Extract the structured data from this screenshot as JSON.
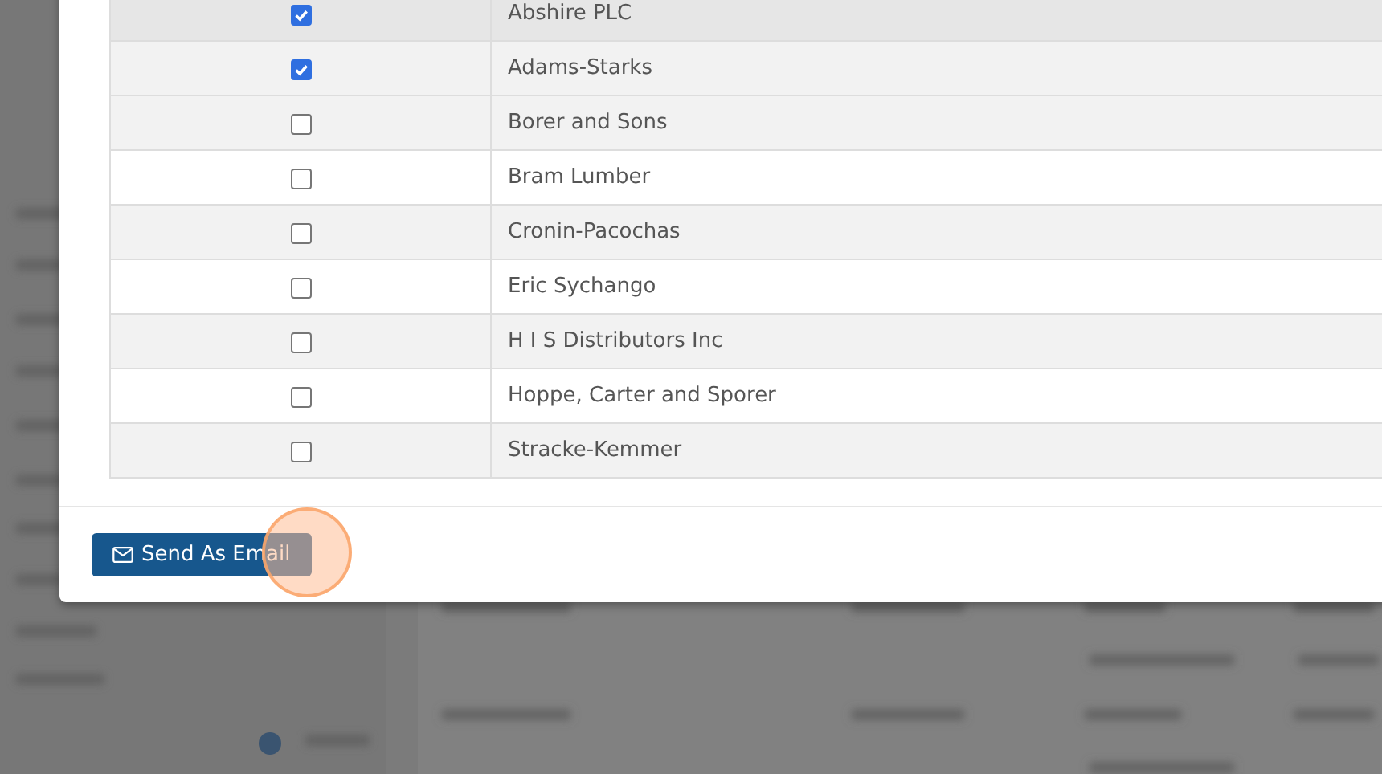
{
  "modal": {
    "rows": [
      {
        "name": "Abshire PLC",
        "checked": true,
        "hovered": true
      },
      {
        "name": "Adams-Starks",
        "checked": true,
        "hovered": false
      },
      {
        "name": "Borer and Sons",
        "checked": false,
        "hovered": false
      },
      {
        "name": "Bram Lumber",
        "checked": false,
        "hovered": false
      },
      {
        "name": "Cronin-Pacochas",
        "checked": false,
        "hovered": false
      },
      {
        "name": "Eric Sychango",
        "checked": false,
        "hovered": false
      },
      {
        "name": "H I S Distributors Inc",
        "checked": false,
        "hovered": false
      },
      {
        "name": "Hoppe, Carter and Sporer",
        "checked": false,
        "hovered": false
      },
      {
        "name": "Stracke-Kemmer",
        "checked": false,
        "hovered": false
      }
    ],
    "send_button": {
      "label": "Send As Email"
    },
    "click_marker": {
      "shown": true
    }
  }
}
